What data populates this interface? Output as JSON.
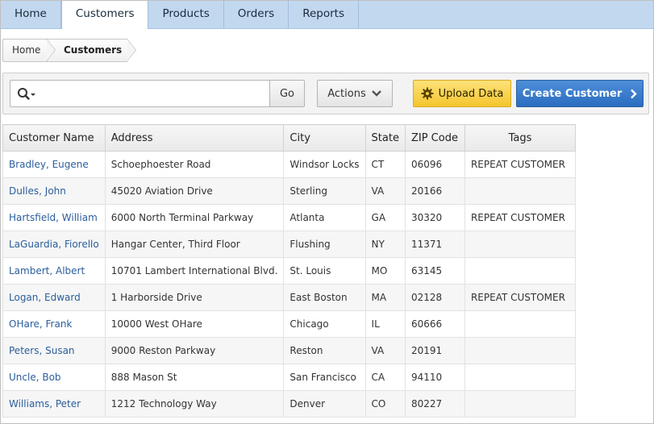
{
  "nav": {
    "tabs": [
      {
        "label": "Home"
      },
      {
        "label": "Customers"
      },
      {
        "label": "Products"
      },
      {
        "label": "Orders"
      },
      {
        "label": "Reports"
      }
    ],
    "active": "Customers"
  },
  "breadcrumb": {
    "home": "Home",
    "current": "Customers"
  },
  "toolbar": {
    "search_value": "",
    "search_placeholder": "",
    "go_label": "Go",
    "actions_label": "Actions",
    "upload_label": "Upload Data",
    "create_label": "Create Customer",
    "upload_color": "#f4c52e",
    "create_color": "#2a6cc0"
  },
  "table": {
    "headers": [
      "Customer Name",
      "Address",
      "City",
      "State",
      "ZIP Code",
      "Tags"
    ],
    "rows": [
      [
        "Bradley, Eugene",
        "Schoephoester Road",
        "Windsor Locks",
        "CT",
        "06096",
        "REPEAT CUSTOMER"
      ],
      [
        "Dulles, John",
        "45020 Aviation Drive",
        "Sterling",
        "VA",
        "20166",
        ""
      ],
      [
        "Hartsfield, William",
        "6000 North Terminal Parkway",
        "Atlanta",
        "GA",
        "30320",
        "REPEAT CUSTOMER"
      ],
      [
        "LaGuardia, Fiorello",
        "Hangar Center, Third Floor",
        "Flushing",
        "NY",
        "11371",
        ""
      ],
      [
        "Lambert, Albert",
        "10701 Lambert International Blvd.",
        "St. Louis",
        "MO",
        "63145",
        ""
      ],
      [
        "Logan, Edward",
        "1 Harborside Drive",
        "East Boston",
        "MA",
        "02128",
        "REPEAT CUSTOMER"
      ],
      [
        "OHare, Frank",
        "10000 West OHare",
        "Chicago",
        "IL",
        "60666",
        ""
      ],
      [
        "Peters, Susan",
        "9000 Reston Parkway",
        "Reston",
        "VA",
        "20191",
        ""
      ],
      [
        "Uncle, Bob",
        "888 Mason St",
        "San Francisco",
        "CA",
        "94110",
        ""
      ],
      [
        "Williams, Peter",
        "1212 Technology Way",
        "Denver",
        "CO",
        "80227",
        ""
      ]
    ],
    "link_color": "#2a5e9c"
  }
}
